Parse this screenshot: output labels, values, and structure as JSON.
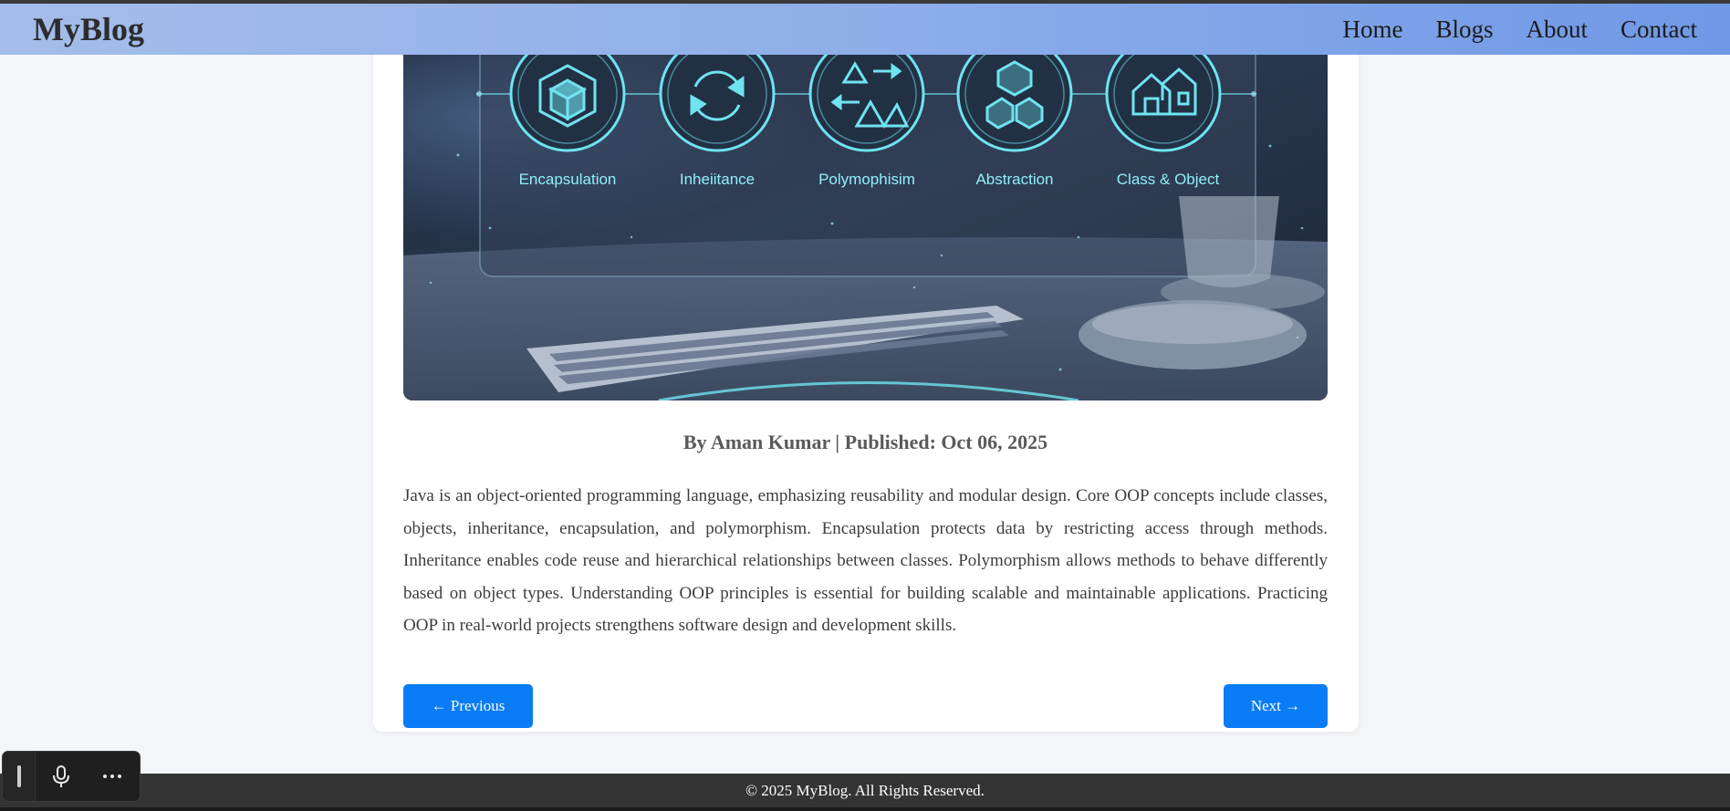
{
  "nav": {
    "brand": "MyBlog",
    "links": [
      "Home",
      "Blogs",
      "About",
      "Contact"
    ]
  },
  "hero": {
    "labels": [
      "Encapsulation",
      "Inheiitance",
      "Polymophisim",
      "Abstraction",
      "Class & Object"
    ]
  },
  "post": {
    "byline": "By Aman Kumar | Published: Oct 06, 2025",
    "content": "Java is an object-oriented programming language, emphasizing reusability and modular design. Core OOP concepts include classes, objects, inheritance, encapsulation, and polymorphism. Encapsulation protects data by restricting access through methods. Inheritance enables code reuse and hierarchical relationships between classes. Polymorphism allows methods to behave differently based on object types. Understanding OOP principles is essential for building scalable and maintainable applications. Practicing OOP in real-world projects strengthens software design and development skills."
  },
  "pager": {
    "prev_label": "← Previous",
    "next_label": "Next →"
  },
  "footer": {
    "text": "© 2025 MyBlog. All Rights Reserved."
  },
  "voice_toolbar": {
    "icons": [
      "drag-handle-icon",
      "microphone-icon",
      "more-icon"
    ]
  },
  "colors": {
    "accent": "#0a7cf5",
    "navbar_start": "#a4bdea",
    "navbar_end": "#6f98e6",
    "footer": "#343434",
    "hero_glow": "#6fe3f0"
  }
}
